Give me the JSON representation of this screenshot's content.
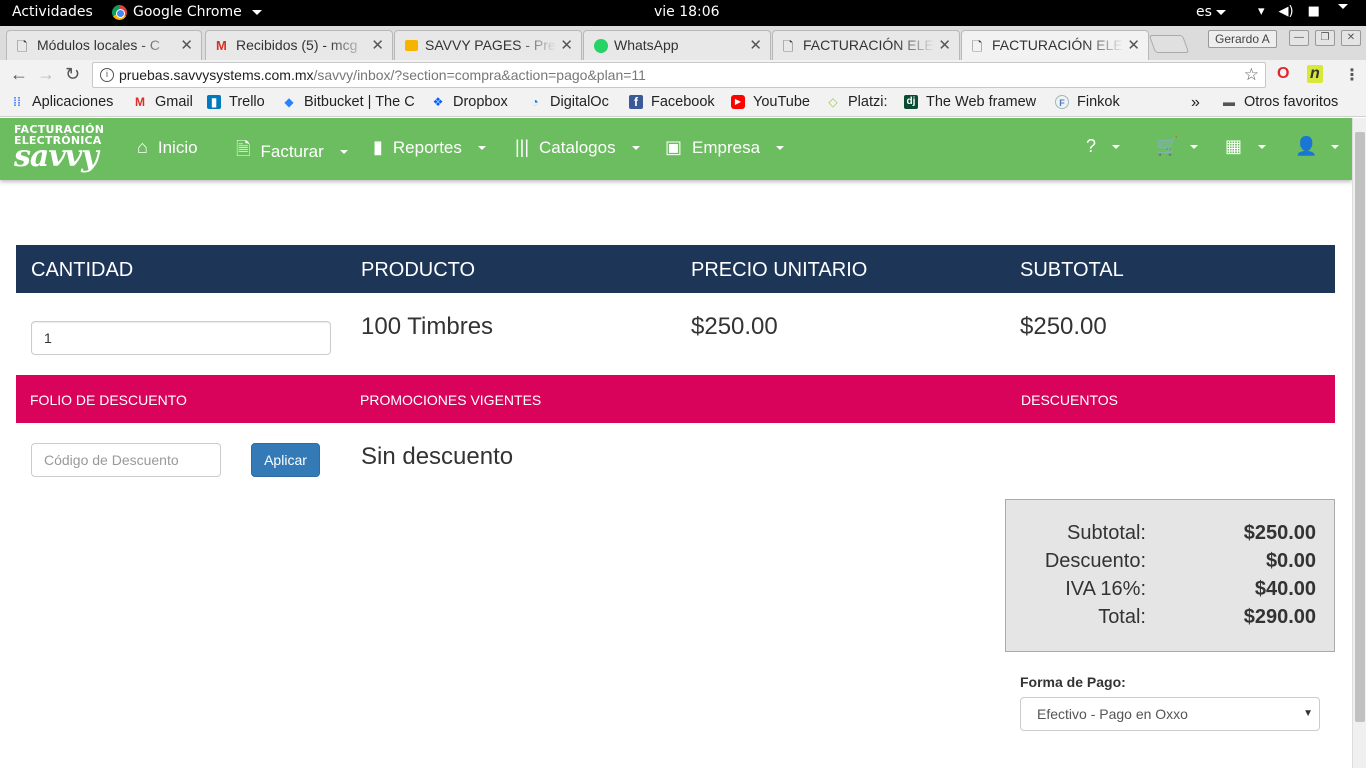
{
  "os": {
    "activities": "Actividades",
    "app_name": "Google Chrome",
    "clock": "vie 18:06",
    "lang": "es"
  },
  "browser": {
    "tabs": [
      {
        "title": "Módulos locales - C",
        "icon": "doc-icon"
      },
      {
        "title": "Recibidos (5) - mcg",
        "icon": "gmail-icon"
      },
      {
        "title": "SAVVY PAGES - Pre",
        "icon": "slides-icon"
      },
      {
        "title": "WhatsApp",
        "icon": "whatsapp-icon"
      },
      {
        "title": "FACTURACIÓN ELE",
        "icon": "doc-icon"
      },
      {
        "title": "FACTURACIÓN ELE",
        "icon": "doc-icon"
      }
    ],
    "profile_name": "Gerardo A",
    "url_host": "pruebas.savvysystems.com.mx",
    "url_path": "/savvy/inbox/?section=compra&action=pago&plan=11",
    "bookmarks": [
      "Aplicaciones",
      "Gmail",
      "Trello",
      "Bitbucket | The C",
      "Dropbox",
      "DigitalOc",
      "Facebook",
      "YouTube",
      "Platzi:",
      "The Web framew",
      "Finkok"
    ],
    "bookmarks_overflow": "»",
    "other_bookmarks": "Otros favoritos"
  },
  "app": {
    "logo": {
      "line1": "FACTURACIÓN",
      "line2": "ELECTRÓNICA",
      "line3": "savvy"
    },
    "nav": [
      {
        "label": "Inicio",
        "icon": "home-icon"
      },
      {
        "label": "Facturar",
        "icon": "file-icon"
      },
      {
        "label": "Reportes",
        "icon": "bar-chart-icon"
      },
      {
        "label": "Catalogos",
        "icon": "barcode-icon"
      },
      {
        "label": "Empresa",
        "icon": "briefcase-icon"
      }
    ],
    "nav_right": [
      "help-icon",
      "cart-icon",
      "apps-grid-icon",
      "user-icon"
    ],
    "colors": {
      "navbar": "#6bbd5f",
      "table_header": "#1d3557",
      "discount_header": "#d9035c",
      "button": "#337ab7"
    }
  },
  "order": {
    "headers": {
      "qty": "CANTIDAD",
      "product": "PRODUCTO",
      "unit_price": "PRECIO UNITARIO",
      "subtotal": "SUBTOTAL"
    },
    "qty_value": "1",
    "product": "100 Timbres",
    "unit_price": "$250.00",
    "subtotal": "$250.00"
  },
  "discount": {
    "headers": {
      "folio": "FOLIO DE DESCUENTO",
      "promos": "PROMOCIONES VIGENTES",
      "discounts": "DESCUENTOS"
    },
    "code_placeholder": "Código de Descuento",
    "apply_label": "Aplicar",
    "no_discount": "Sin descuento"
  },
  "totals": {
    "subtotal_label": "Subtotal:",
    "subtotal": "$250.00",
    "discount_label": "Descuento:",
    "discount": "$0.00",
    "iva_label": "IVA 16%:",
    "iva": "$40.00",
    "total_label": "Total:",
    "total": "$290.00"
  },
  "payment": {
    "label": "Forma de Pago:",
    "selected": "Efectivo - Pago en Oxxo"
  }
}
